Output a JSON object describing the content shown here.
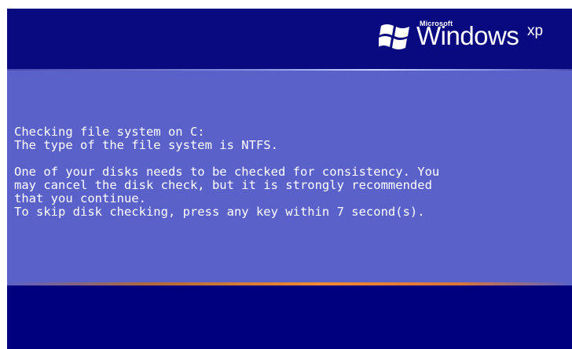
{
  "logo": {
    "brand_small": "Microsoft",
    "brand_main": "Windows",
    "brand_sup": "xp",
    "icon": "windows-flag-icon"
  },
  "message": {
    "line1": "Checking file system on C:",
    "line2": "The type of the file system is NTFS.",
    "line3": "One of your disks needs to be checked for consistency. You",
    "line4": "may cancel the disk check, but it is strongly recommended",
    "line5": "that you continue.",
    "line6": "To skip disk checking, press any key within 7 second(s)."
  },
  "countdown_seconds": 7,
  "colors": {
    "background": "#00007e",
    "panel": "#5a61c8",
    "text": "#ffffff",
    "accent": "#f08a30"
  }
}
